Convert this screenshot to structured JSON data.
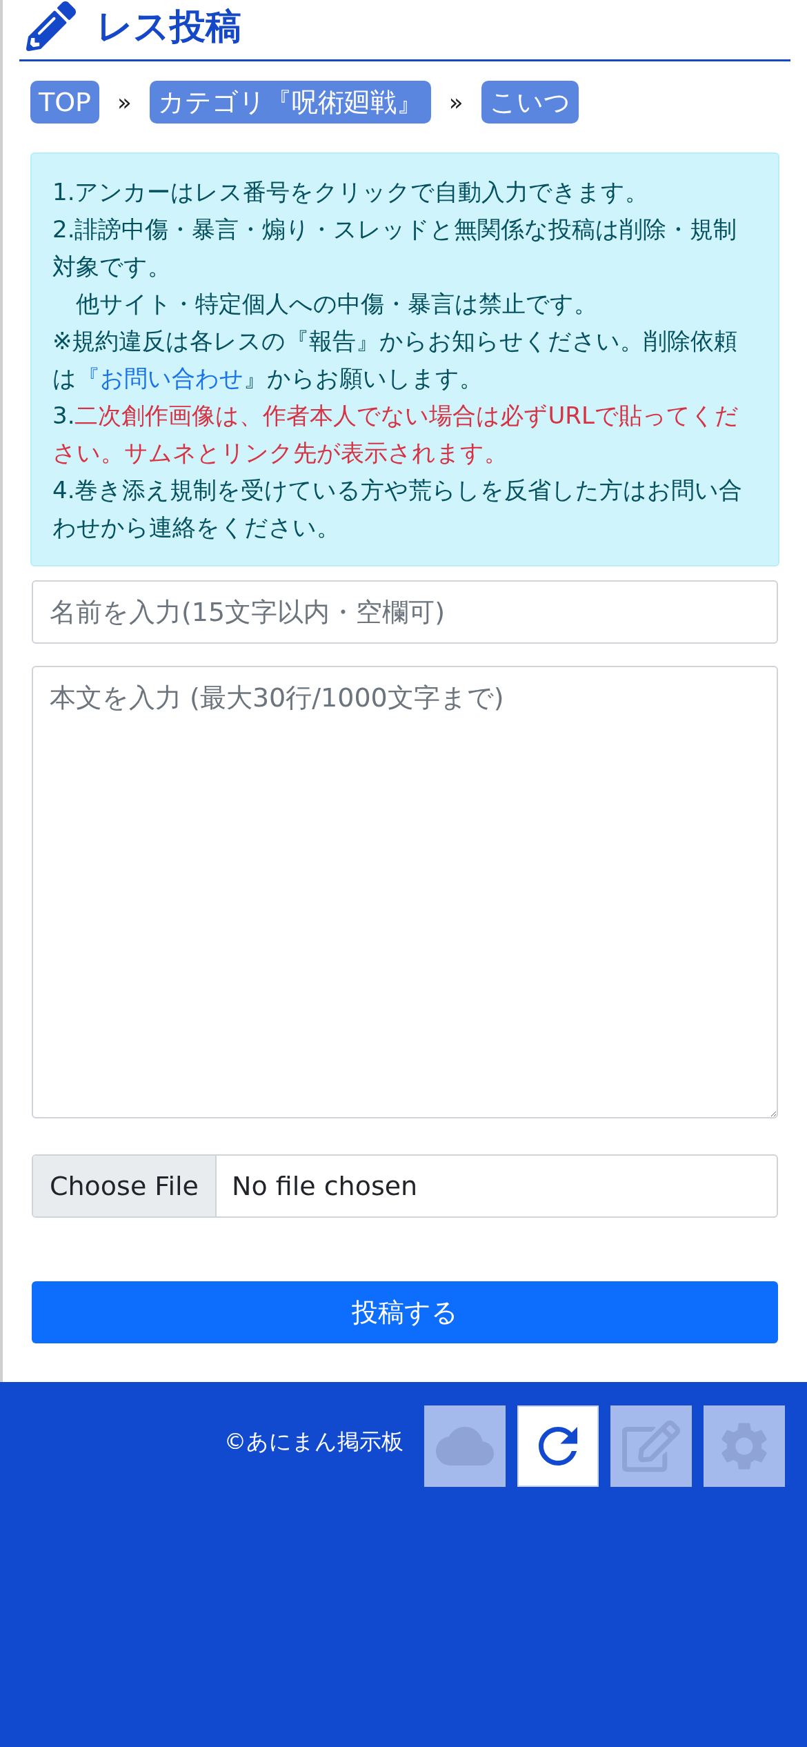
{
  "header": {
    "title": "レス投稿"
  },
  "breadcrumbs": [
    {
      "label": "TOP"
    },
    {
      "label": "カテゴリ『呪術廻戦』"
    },
    {
      "label": "こいつ"
    }
  ],
  "breadcrumb_separator": "»",
  "notice": [
    {
      "kind": "plain",
      "text": "1.アンカーはレス番号をクリックで自動入力できます。"
    },
    {
      "kind": "plain",
      "text": "2.誹謗中傷・暴言・煽り・スレッドと無関係な投稿は削除・規制対象です。"
    },
    {
      "kind": "plain",
      "text": "　他サイト・特定個人への中傷・暴言は禁止です。"
    },
    {
      "kind": "link_line",
      "before": "※規約違反は各レスの『報告』からお知らせください。削除依頼は",
      "link": "『お問い合わせ",
      "after": "』からお願いします。"
    },
    {
      "kind": "warning",
      "prefix": "3.",
      "text": "二次創作画像は、作者本人でない場合は必ずURLで貼ってください。サムネとリンク先が表示されます。"
    },
    {
      "kind": "plain",
      "text": "4.巻き添え規制を受けている方や荒らしを反省した方はお問い合わせから連絡をください。"
    }
  ],
  "form": {
    "name_placeholder": "名前を入力(15文字以内・空欄可)",
    "body_placeholder": "本文を入力 (最大30行/1000文字まで)",
    "file_button": "Choose File",
    "file_status": "No file chosen",
    "submit": "投稿する"
  },
  "footer": {
    "copyright": "©あにまん掲示板"
  },
  "floating_buttons": [
    {
      "kind": "cloud",
      "active": false
    },
    {
      "kind": "refresh",
      "active": true
    },
    {
      "kind": "edit",
      "active": false
    },
    {
      "kind": "settings",
      "active": false
    }
  ]
}
